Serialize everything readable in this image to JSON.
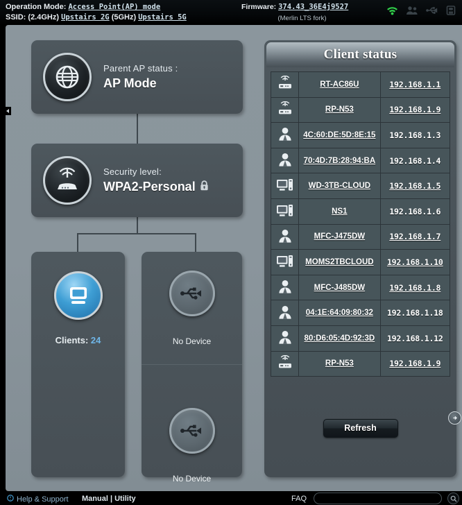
{
  "topbar": {
    "operation_mode_label": "Operation Mode:",
    "operation_mode_value": "Access Point(AP) mode",
    "ssid_label": "SSID:",
    "band_24_label": "(2.4GHz)",
    "ssid_24": "Upstairs 2G",
    "band_5_label": "(5GHz)",
    "ssid_5": "Upstairs 5G",
    "firmware_label": "Firmware:",
    "firmware_value": "374.43_36E4j9527",
    "firmware_note": "(Merlin LTS fork)",
    "icons": [
      "wifi-icon",
      "users-icon",
      "usb-icon",
      "printer-icon"
    ]
  },
  "left": {
    "ap": {
      "icon": "globe-icon",
      "title": "Parent AP status :",
      "value": "AP Mode"
    },
    "security": {
      "icon": "router-signal-icon",
      "title": "Security level:",
      "value": "WPA2-Personal",
      "lock_icon": "lock-icon"
    },
    "clients": {
      "icon": "monitor-icon",
      "label": "Clients:",
      "count": "24"
    },
    "usb": [
      {
        "icon": "usb-icon",
        "label": "No Device"
      },
      {
        "icon": "usb-icon",
        "label": "No Device"
      }
    ]
  },
  "client_status": {
    "title": "Client status",
    "refresh_label": "Refresh",
    "next_icon": "arrow-right-circle-icon",
    "rows": [
      {
        "icon": "router-icon",
        "name": "RT-AC86U",
        "name_link": true,
        "ip": "192.168.1.1",
        "ip_link": true
      },
      {
        "icon": "router-icon",
        "name": "RP-N53",
        "name_link": true,
        "ip": "192.168.1.9",
        "ip_link": true
      },
      {
        "icon": "person-icon",
        "name": "4C:60:DE:5D:8E:15",
        "name_link": true,
        "ip": "192.168.1.3",
        "ip_link": false
      },
      {
        "icon": "person-icon",
        "name": "70:4D:7B:28:94:BA",
        "name_link": true,
        "ip": "192.168.1.4",
        "ip_link": false
      },
      {
        "icon": "desktop-icon",
        "name": "WD-3TB-CLOUD",
        "name_link": true,
        "ip": "192.168.1.5",
        "ip_link": true
      },
      {
        "icon": "desktop-icon",
        "name": "NS1",
        "name_link": true,
        "ip": "192.168.1.6",
        "ip_link": false
      },
      {
        "icon": "person-icon",
        "name": "MFC-J475DW",
        "name_link": true,
        "ip": "192.168.1.7",
        "ip_link": true
      },
      {
        "icon": "desktop-icon",
        "name": "MOMS2TBCLOUD",
        "name_link": true,
        "ip": "192.168.1.10",
        "ip_link": true
      },
      {
        "icon": "person-icon",
        "name": "MFC-J485DW",
        "name_link": true,
        "ip": "192.168.1.8",
        "ip_link": true
      },
      {
        "icon": "person-icon",
        "name": "04:1E:64:09:80:32",
        "name_link": true,
        "ip": "192.168.1.18",
        "ip_link": false
      },
      {
        "icon": "person-icon",
        "name": "80:D6:05:4D:92:3D",
        "name_link": true,
        "ip": "192.168.1.12",
        "ip_link": false
      },
      {
        "icon": "router-icon",
        "name": "RP-N53",
        "name_link": true,
        "ip": "192.168.1.9",
        "ip_link": true
      }
    ]
  },
  "bottom": {
    "help_label": "Help & Support",
    "manual_label": "Manual | Utility",
    "faq_label": "FAQ",
    "search_placeholder": "",
    "search_value": "",
    "search_icon": "search-icon",
    "help_icon": "help-icon"
  },
  "colors": {
    "stage_bg": "#8a959c",
    "panel_bg": "#4b545a",
    "accent_blue": "#6fb6e8",
    "wifi_green": "#31d04a",
    "link": "#ffffff"
  }
}
